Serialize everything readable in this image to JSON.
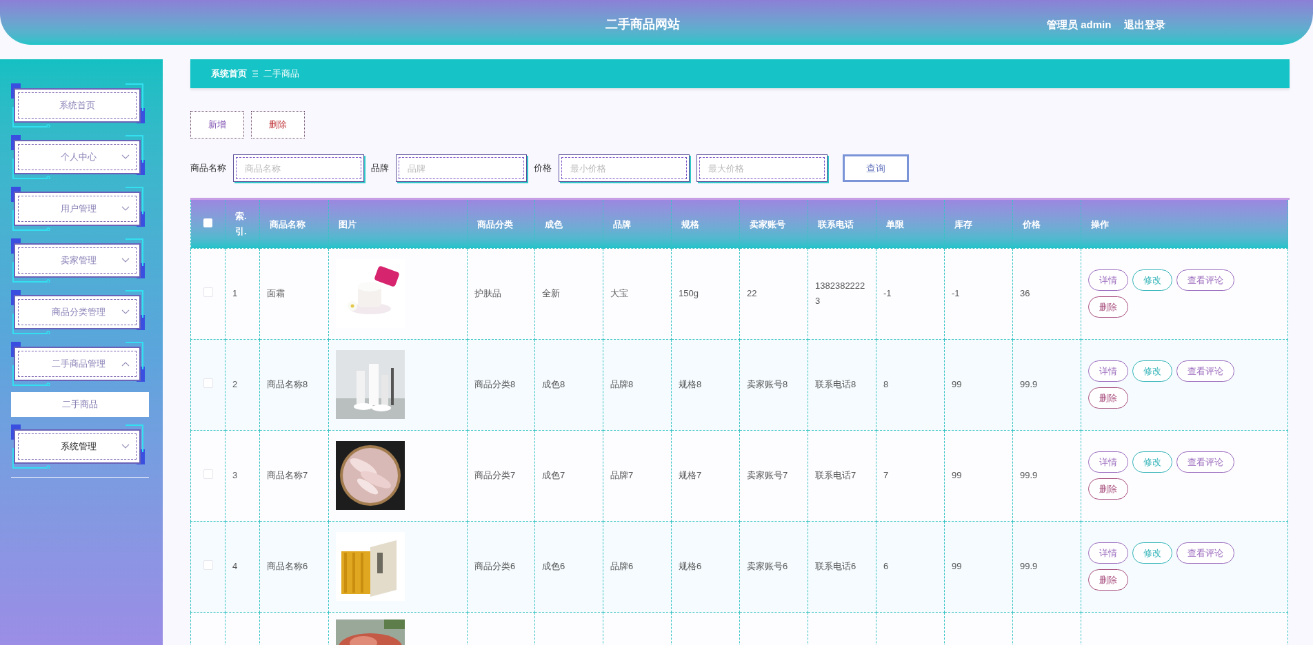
{
  "header": {
    "title": "二手商品网站",
    "user": "管理员 admin",
    "logout": "退出登录"
  },
  "sidebar": {
    "items": [
      {
        "label": "系统首页",
        "kind": "link"
      },
      {
        "label": "个人中心",
        "kind": "group",
        "expanded": false
      },
      {
        "label": "用户管理",
        "kind": "group",
        "expanded": false
      },
      {
        "label": "卖家管理",
        "kind": "group",
        "expanded": false
      },
      {
        "label": "商品分类管理",
        "kind": "group",
        "expanded": false
      },
      {
        "label": "二手商品管理",
        "kind": "group",
        "expanded": true,
        "children": [
          {
            "label": "二手商品"
          }
        ]
      },
      {
        "label": "系统管理",
        "kind": "group",
        "expanded": false
      }
    ]
  },
  "breadcrumb": [
    "系统首页",
    "二手商品"
  ],
  "toolbar": [
    {
      "label": "新增",
      "kind": "add"
    },
    {
      "label": "删除",
      "kind": "delete"
    }
  ],
  "search": {
    "fields": [
      {
        "label": "商品名称",
        "placeholder": "商品名称"
      },
      {
        "label": "品牌",
        "placeholder": "品牌"
      },
      {
        "label": "价格",
        "placeholder": "最小价格"
      },
      {
        "placeholder": "最大价格"
      }
    ],
    "button": "查询"
  },
  "table": {
    "header_checked": false,
    "columns": [
      "索.引.",
      "商品名称",
      "图片",
      "商品分类",
      "成色",
      "品牌",
      "规格",
      "卖家账号",
      "联系电话",
      "单限",
      "库存",
      "价格",
      "操作"
    ],
    "rows": [
      {
        "checked": false,
        "cells": [
          "1",
          "面霜",
          "",
          "护肤品",
          "全新",
          "大宝",
          "150g",
          "22",
          "13823822223",
          "-1",
          "-1",
          "36"
        ],
        "actions": [
          {
            "label": "详情",
            "kind": "detail"
          },
          {
            "label": "修改",
            "kind": "edit"
          },
          {
            "label": "查看评论",
            "kind": "comments"
          },
          {
            "label": "删除",
            "kind": "delete"
          }
        ]
      },
      {
        "checked": false,
        "cells": [
          "2",
          "商品名称8",
          "",
          "商品分类8",
          "成色8",
          "品牌8",
          "规格8",
          "卖家账号8",
          "联系电话8",
          "8",
          "99",
          "99.9"
        ],
        "actions": [
          {
            "label": "详情",
            "kind": "detail"
          },
          {
            "label": "修改",
            "kind": "edit"
          },
          {
            "label": "查看评论",
            "kind": "comments"
          },
          {
            "label": "删除",
            "kind": "delete"
          }
        ]
      },
      {
        "checked": false,
        "cells": [
          "3",
          "商品名称7",
          "",
          "商品分类7",
          "成色7",
          "品牌7",
          "规格7",
          "卖家账号7",
          "联系电话7",
          "7",
          "99",
          "99.9"
        ],
        "actions": [
          {
            "label": "详情",
            "kind": "detail"
          },
          {
            "label": "修改",
            "kind": "edit"
          },
          {
            "label": "查看评论",
            "kind": "comments"
          },
          {
            "label": "删除",
            "kind": "delete"
          }
        ]
      },
      {
        "checked": false,
        "cells": [
          "4",
          "商品名称6",
          "",
          "商品分类6",
          "成色6",
          "品牌6",
          "规格6",
          "卖家账号6",
          "联系电话6",
          "6",
          "99",
          "99.9"
        ],
        "actions": [
          {
            "label": "详情",
            "kind": "detail"
          },
          {
            "label": "修改",
            "kind": "edit"
          },
          {
            "label": "查看评论",
            "kind": "comments"
          },
          {
            "label": "删除",
            "kind": "delete"
          }
        ]
      }
    ]
  }
}
